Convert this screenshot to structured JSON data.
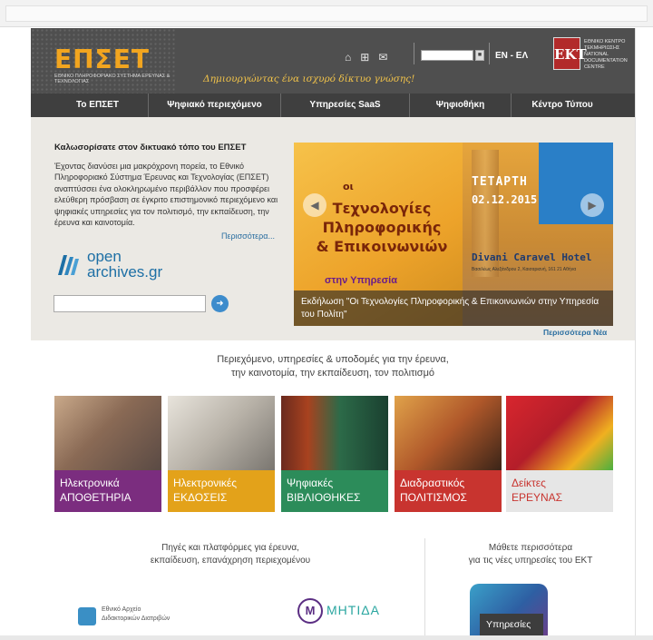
{
  "header": {
    "logo": "ΕΠΣΕΤ",
    "logo_sub": "ΕΘΝΙΚΟ ΠΛΗΡΟΦΟΡΙΑΚΟ ΣΥΣΤΗΜΑ ΕΡΕΥΝΑΣ & ΤΕΧΝΟΛΟΓΙΑΣ",
    "slogan": "Δημιουργώντας ένα ισχυρό δίκτυο γνώσης!",
    "lang": "EN - ΕΛ",
    "ekt_mark": "ΕΚΤ",
    "ekt_text": "ΕΘΝΙΚΟ ΚΕΝΤΡΟ ΤΕΚΜΗΡΙΩΣΗΣ NATIONAL DOCUMENTATION CENTRE",
    "icons": [
      "home-icon",
      "sitemap-icon",
      "mail-icon"
    ]
  },
  "nav": [
    "Το ΕΠΣΕΤ",
    "Ψηφιακό περιεχόμενο",
    "Υπηρεσίες SaaS",
    "Ψηφιοθήκη",
    "Κέντρο Τύπου"
  ],
  "intro": {
    "welcome": "Καλωσορίσατε στον δικτυακό τόπο του ΕΠΣΕΤ",
    "text": "Έχοντας διανύσει μια μακρόχρονη πορεία, το Εθνικό Πληροφοριακό Σύστημα Έρευνας και Τεχνολογίας (ΕΠΣΕΤ) αναπτύσσει ένα ολοκληρωμένο περιβάλλον που προσφέρει ελεύθερη πρόσβαση σε έγκριτο επιστημονικό περιεχόμενο και ψηφιακές υπηρεσίες για τον πολιτισμό, την εκπαίδευση, την έρευνα και καινοτομία.",
    "more": "Περισσότερα...",
    "openarchives_line1": "open",
    "openarchives_line2": "archives.gr"
  },
  "banner": {
    "t1": "οι",
    "t2": "Τεχνολογίες Πληροφορικής & Επικοινωνιών",
    "t3": "στην Υπηρεσία",
    "day": "ΤΕΤΑΡΤΗ",
    "date": "02.12.2015",
    "venue": "Divani Caravel Hotel",
    "address": "Βασιλέως Αλεξάνδρου 2, Καισαριανή, 161 21 Αθήνα",
    "caption": "Εκδήλωση \"Οι Τεχνολογίες Πληροφορικής & Επικοινωνιών στην Υπηρεσία του Πολίτη\"",
    "more_news": "Περισσότερα Νέα"
  },
  "content": {
    "heading_line1": "Περιεχόμενο, υπηρεσίες & υποδομές για την έρευνα,",
    "heading_line2": "την καινοτομία, την εκπαίδευση, τον πολιτισμό",
    "tiles": [
      {
        "line1": "Ηλεκτρονικά",
        "line2": "ΑΠΟΘΕΤΗΡΙΑ",
        "color": "#7b2d7f"
      },
      {
        "line1": "Ηλεκτρονικές",
        "line2": "ΕΚΔΟΣΕΙΣ",
        "color": "#e3a21a"
      },
      {
        "line1": "Ψηφιακές",
        "line2": "ΒΙΒΛΙΟΘΗΚΕΣ",
        "color": "#2c8c5a"
      },
      {
        "line1": "Διαδραστικός",
        "line2": "ΠΟΛΙΤΙΣΜΟΣ",
        "color": "#c8342f"
      },
      {
        "line1": "Δείκτες",
        "line2": "ΕΡΕΥΝΑΣ",
        "color": "#d9d9d9"
      }
    ],
    "sources_line1": "Πηγές και πλατφόρμες για έρευνα,",
    "sources_line2": "εκπαίδευση, επανάχρηση περιεχομένου",
    "learn_line1": "Μάθετε περισσότερα",
    "learn_line2": "για τις νέες υπηρεσίες του ΕΚΤ",
    "edad_line1": "Εθνικό Αρχείο",
    "edad_line2": "Διδακτορικών Διατριβών",
    "mitida_mark": "M",
    "mitida": "ΜΗΤΙΔΑ",
    "services_tag": "Υπηρεσίες"
  }
}
